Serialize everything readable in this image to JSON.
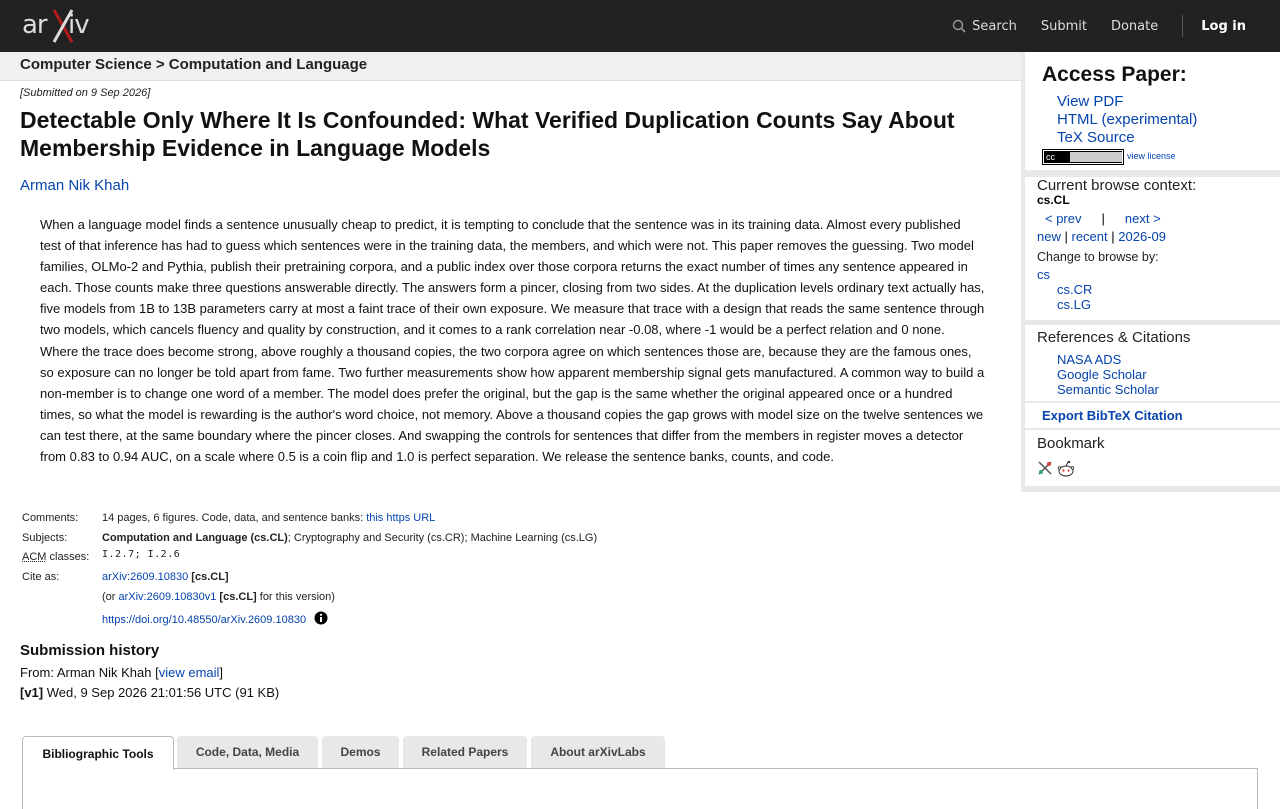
{
  "topbar": {
    "logo_alt": "arXiv",
    "nav": {
      "search": "Search",
      "submit": "Submit",
      "donate": "Donate",
      "login": "Log in"
    }
  },
  "header": {
    "breadcrumb": "Computer Science > Computation and Language"
  },
  "paper": {
    "dateline": "[Submitted on 9 Sep 2026]",
    "title": "Detectable Only Where It Is Confounded: What Verified Duplication Counts Say About Membership Evidence in Language Models",
    "author": "Arman Nik Khah",
    "abstract": "When a language model finds a sentence unusually cheap to predict, it is tempting to conclude that the sentence was in its training data. Almost every published test of that inference has had to guess which sentences were in the training data, the members, and which were not. This paper removes the guessing. Two model families, OLMo-2 and Pythia, publish their pretraining corpora, and a public index over those corpora returns the exact number of times any sentence appeared in each. Those counts make three questions answerable directly. The answers form a pincer, closing from two sides. At the duplication levels ordinary text actually has, five models from 1B to 13B parameters carry at most a faint trace of their own exposure. We measure that trace with a design that reads the same sentence through two models, which cancels fluency and quality by construction, and it comes to a rank correlation near -0.08, where -1 would be a perfect relation and 0 none. Where the trace does become strong, above roughly a thousand copies, the two corpora agree on which sentences those are, because they are the famous ones, so exposure can no longer be told apart from fame. Two further measurements show how apparent membership signal gets manufactured. A common way to build a non-member is to change one word of a member. The model does prefer the original, but the gap is the same whether the original appeared once or a hundred times, so what the model is rewarding is the author's word choice, not memory. Above a thousand copies the gap grows with model size on the twelve sentences we can test there, at the same boundary where the pincer closes. And swapping the controls for sentences that differ from the members in register moves a detector from 0.83 to 0.94 AUC, on a scale where 0.5 is a coin flip and 1.0 is perfect separation. We release the sentence banks, counts, and code."
  },
  "meta": {
    "comments_label": "Comments:",
    "comments_text": "14 pages, 6 figures. Code, data, and sentence banks: ",
    "comments_link": "this https URL",
    "subjects_label": "Subjects:",
    "subjects_primary": "Computation and Language (cs.CL)",
    "subjects_rest": "; Cryptography and Security (cs.CR); Machine Learning (cs.LG)",
    "acm_abbr": "ACM",
    "acm_label_rest": " classes:",
    "acm_value": "I.2.7; I.2.6",
    "cite_label": "Cite as:",
    "cite_id": "arXiv:2609.10830",
    "cite_cat": "[cs.CL]",
    "cite_or": "(or ",
    "cite_v1": "arXiv:2609.10830v1",
    "cite_v1_cat": "[cs.CL]",
    "cite_v1_tail": " for this version)",
    "doi": "https://doi.org/10.48550/arXiv.2609.10830"
  },
  "history": {
    "heading": "Submission history",
    "from_prefix": "From: Arman Nik Khah [",
    "view_email": "view email",
    "from_suffix": "]",
    "v1_tag": "[v1]",
    "v1_text": " Wed, 9 Sep 2026 21:01:56 UTC (91 KB)"
  },
  "tabs": [
    "Bibliographic Tools",
    "Code, Data, Media",
    "Demos",
    "Related Papers",
    "About arXivLabs"
  ],
  "sidebar": {
    "access_heading": "Access Paper:",
    "access_links": [
      "View PDF",
      "HTML (experimental)",
      "TeX Source"
    ],
    "license_badge": "cc",
    "view_license": "view license",
    "context_heading": "Current browse context:",
    "context_code": "cs.CL",
    "prev": "< prev",
    "pipe": "|",
    "next": "next >",
    "new": "new",
    "recent": "recent",
    "month": "2026-09",
    "change_browse": "Change to browse by:",
    "browse": [
      "cs",
      "cs.CR",
      "cs.LG"
    ],
    "refs_heading": "References & Citations",
    "refs": [
      "NASA ADS",
      "Google Scholar",
      "Semantic Scholar"
    ],
    "bibtex": "Export BibTeX Citation",
    "bookmark_heading": "Bookmark"
  },
  "colors": {
    "topbar": "#222222",
    "link": "#0645ad",
    "logo_x": "#b31b1b",
    "sidebar_bg": "#e8e8e8"
  }
}
